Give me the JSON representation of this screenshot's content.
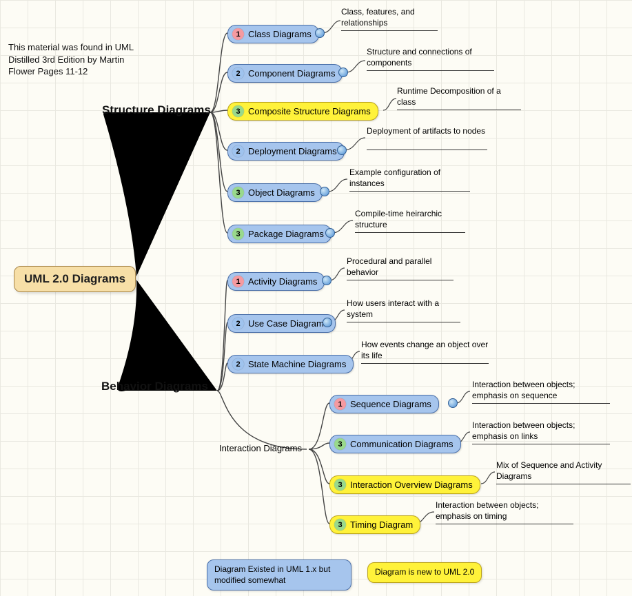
{
  "annotation": "This material was found in UML Distilled 3rd Edition by Martin Flower Pages 11-12",
  "root": "UML 2.0 Diagrams",
  "branches": {
    "structure": "Structure Diagrams",
    "behavior": "Behavior Diagrams",
    "interaction": "Interaction Diagrams"
  },
  "nodes": {
    "class": {
      "num": "1",
      "label": "Class Diagrams",
      "desc": "Class, features, and relationships"
    },
    "component": {
      "num": "2",
      "label": "Component Diagrams",
      "desc": "Structure and connections of components"
    },
    "composite": {
      "num": "3",
      "label": "Composite Structure Diagrams",
      "desc": "Runtime Decomposition of a class"
    },
    "deployment": {
      "num": "2",
      "label": "Deployment Diagrams",
      "desc": "Deployment of artifacts to nodes"
    },
    "object": {
      "num": "3",
      "label": "Object Diagrams",
      "desc": "Example configuration of instances"
    },
    "package": {
      "num": "3",
      "label": "Package Diagrams",
      "desc": "Compile-time heirarchic structure"
    },
    "activity": {
      "num": "1",
      "label": "Activity Diagrams",
      "desc": "Procedural and parallel behavior"
    },
    "usecase": {
      "num": "2",
      "label": "Use Case Diagrams",
      "desc": "How users interact with a system"
    },
    "statemachine": {
      "num": "2",
      "label": "State Machine Diagrams",
      "desc": "How events change an object over its life"
    },
    "sequence": {
      "num": "1",
      "label": "Sequence Diagrams",
      "desc": "Interaction between objects; emphasis on sequence"
    },
    "communication": {
      "num": "3",
      "label": "Communication Diagrams",
      "desc": "Interaction between objects; emphasis on links"
    },
    "overview": {
      "num": "3",
      "label": "Interaction Overview Diagrams",
      "desc": "Mix of Sequence and Activity Diagrams"
    },
    "timing": {
      "num": "3",
      "label": "Timing Diagram",
      "desc": "Interaction between objects; emphasis on timing"
    }
  },
  "legend": {
    "blue": "Diagram Existed in UML 1.x but modified somewhat",
    "yellow": "Diagram is new to UML 2.0"
  }
}
